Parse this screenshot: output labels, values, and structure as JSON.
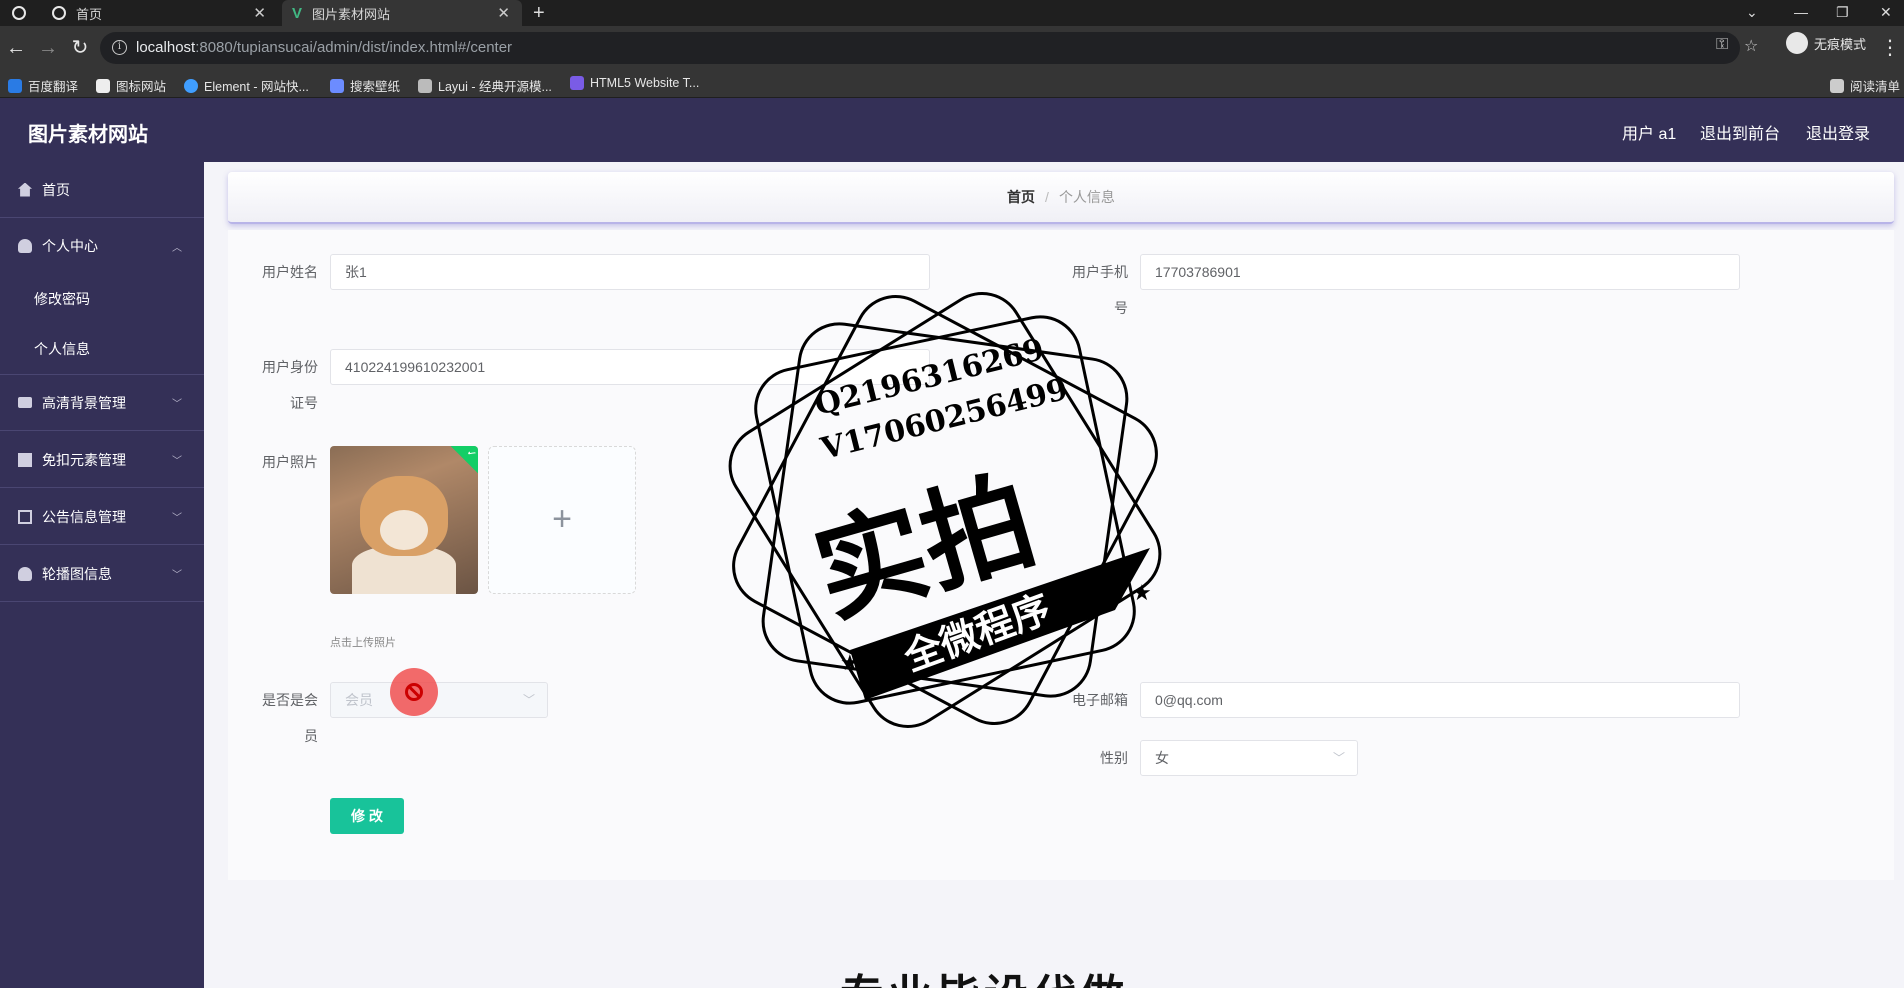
{
  "browser": {
    "tabs": [
      {
        "title": "首页"
      },
      {
        "title": "图片素材网站"
      }
    ],
    "url_host": "localhost",
    "url_rest": ":8080/tupiansucai/admin/dist/index.html#/center",
    "incognito_label": "无痕模式",
    "bookmarks": [
      "百度翻译",
      "图标网站",
      "Element - 网站快...",
      "搜索壁纸",
      "Layui - 经典开源模...",
      "HTML5 Website T..."
    ],
    "reading_list": "阅读清单"
  },
  "header": {
    "brand": "图片素材网站",
    "user": "用户 a1",
    "to_front": "退出到前台",
    "logout": "退出登录"
  },
  "sidebar": {
    "home": "首页",
    "personal": "个人中心",
    "change_pwd": "修改密码",
    "personal_info": "个人信息",
    "hd_bg": "高清背景管理",
    "cutout": "免扣元素管理",
    "notice": "公告信息管理",
    "carousel": "轮播图信息"
  },
  "breadcrumb": {
    "home": "首页",
    "sep": "/",
    "current": "个人信息"
  },
  "form": {
    "name_label": "用户姓名",
    "name_value": "张1",
    "phone_label_1": "用户手机",
    "phone_label_2": "号",
    "phone_value": "17703786901",
    "id_label_1": "用户身份",
    "id_label_2": "证号",
    "id_value": "410224199610232001",
    "photo_label": "用户照片",
    "upload_plus": "+",
    "upload_hint": "点击上传照片",
    "member_label_1": "是否是会",
    "member_label_2": "员",
    "member_value": "会员",
    "email_label": "电子邮箱",
    "email_value": "0@qq.com",
    "gender_label": "性别",
    "gender_value": "女",
    "submit": "修 改"
  },
  "watermark": {
    "line1": "Q2196316269",
    "line2": "V17060256499",
    "big": "实拍",
    "ribbon": "全微程序",
    "bottom": "专业毕设代做"
  }
}
